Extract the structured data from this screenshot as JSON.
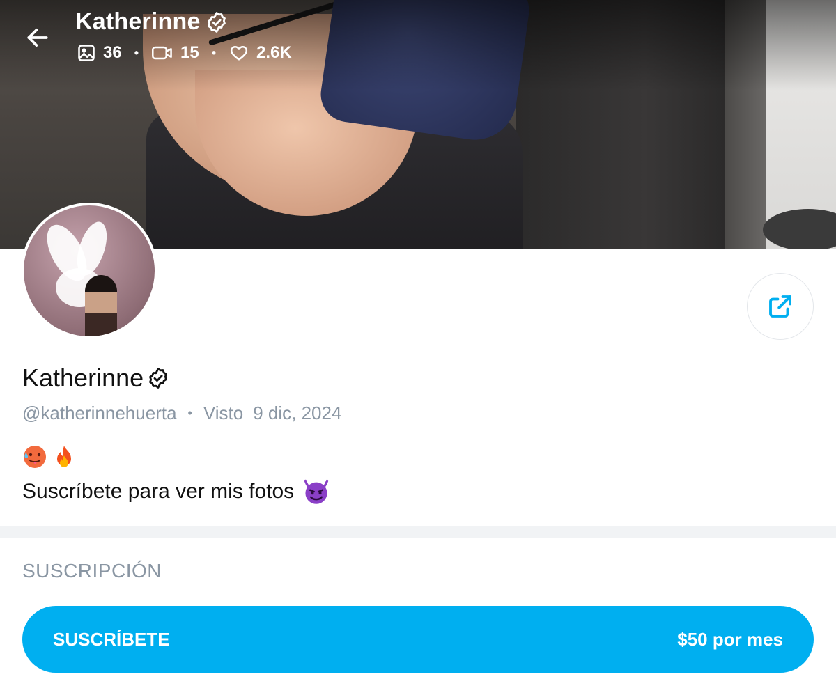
{
  "header": {
    "title": "Katherinne",
    "stats": {
      "photos": "36",
      "videos": "15",
      "likes": "2.6K"
    }
  },
  "icons": {
    "back": "arrow-left-icon",
    "verified": "verified-badge-icon",
    "photos": "image-icon",
    "videos": "video-icon",
    "likes": "heart-icon",
    "share": "share-icon"
  },
  "profile": {
    "display_name": "Katherinne",
    "handle": "@katherinnehuerta",
    "seen_label": "Visto",
    "seen_date": "9 dic, 2024",
    "bio_emojis": "🥵🔥",
    "bio_text": "Suscríbete para ver mis fotos",
    "bio_text_emoji": "😈"
  },
  "subscription": {
    "section_label": "SUSCRIPCIÓN",
    "button_label": "SUSCRÍBETE",
    "price": "$50 por mes"
  },
  "colors": {
    "accent": "#00aff0",
    "muted_text": "#8a96a3",
    "divider": "#f1f3f5"
  }
}
